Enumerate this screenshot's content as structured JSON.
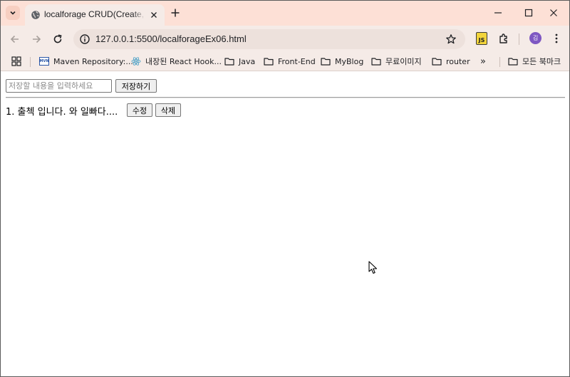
{
  "browser": {
    "tab": {
      "title": "localforage CRUD(Create, Read, Update, Delete)"
    },
    "address_bar": {
      "url": "127.0.0.1:5500/localforageEx06.html"
    },
    "profile_initial": "김",
    "js_extension_label": "JS",
    "bookmarks": [
      {
        "label": "Maven Repository:...",
        "icon": "mvn-icon"
      },
      {
        "label": "내장된 React Hook...",
        "icon": "react-icon"
      },
      {
        "label": "Java",
        "icon": "folder-icon"
      },
      {
        "label": "Front-End",
        "icon": "folder-icon"
      },
      {
        "label": "MyBlog",
        "icon": "folder-icon"
      },
      {
        "label": "무료이미지",
        "icon": "folder-icon"
      },
      {
        "label": "router",
        "icon": "folder-icon"
      }
    ],
    "bookmarks_overflow": "»",
    "all_bookmarks": "모든 북마크",
    "mvn_icon_text": "MVN"
  },
  "page": {
    "input": {
      "value": "",
      "placeholder": "저장할 내용을 입력하세요"
    },
    "save_button": "저장하기",
    "memos": [
      {
        "text": "1. 출첵 입니다. 와 일빠다....",
        "edit_label": "수정",
        "delete_label": "삭제"
      }
    ]
  }
}
